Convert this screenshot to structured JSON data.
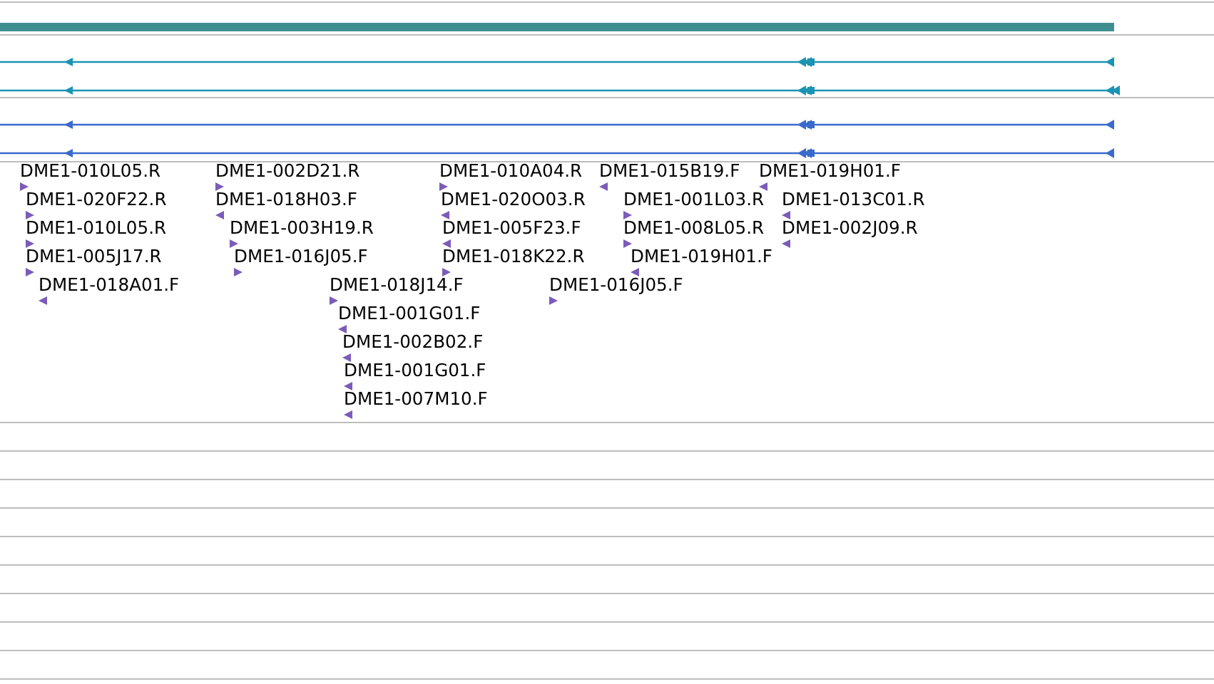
{
  "transcripts": [
    {
      "color": "#1b93b3"
    },
    {
      "color": "#1b93b3"
    },
    {
      "color": "#3a6acc"
    },
    {
      "color": "#3a6acc"
    }
  ],
  "reads": [
    {
      "label": "DME1-010L05.R",
      "kind": "forward"
    },
    {
      "label": "DME1-020F22.R",
      "kind": "forward"
    },
    {
      "label": "DME1-010L05.R",
      "kind": "forward"
    },
    {
      "label": "DME1-005J17.R",
      "kind": "forward"
    },
    {
      "label": "DME1-018A01.F",
      "kind": "reverse"
    },
    {
      "label": "DME1-002D21.R",
      "kind": "forward"
    },
    {
      "label": "DME1-018H03.F",
      "kind": "reverse"
    },
    {
      "label": "DME1-003H19.R",
      "kind": "forward"
    },
    {
      "label": "DME1-016J05.F",
      "kind": "forward"
    },
    {
      "label": "DME1-018J14.F",
      "kind": "forward"
    },
    {
      "label": "DME1-001G01.F",
      "kind": "reverse"
    },
    {
      "label": "DME1-002B02.F",
      "kind": "reverse"
    },
    {
      "label": "DME1-001G01.F",
      "kind": "reverse"
    },
    {
      "label": "DME1-007M10.F",
      "kind": "reverse"
    },
    {
      "label": "DME1-010A04.R",
      "kind": "forward"
    },
    {
      "label": "DME1-020O03.R",
      "kind": "reverse"
    },
    {
      "label": "DME1-005F23.F",
      "kind": "reverse"
    },
    {
      "label": "DME1-018K22.R",
      "kind": "forward"
    },
    {
      "label": "DME1-016J05.F",
      "kind": "forward"
    },
    {
      "label": "DME1-015B19.F",
      "kind": "reverse"
    },
    {
      "label": "DME1-001L03.R",
      "kind": "forward"
    },
    {
      "label": "DME1-008L05.R",
      "kind": "forward"
    },
    {
      "label": "DME1-019H01.F",
      "kind": "reverse"
    },
    {
      "label": "DME1-019H01.F",
      "kind": "reverse"
    },
    {
      "label": "DME1-013C01.R",
      "kind": "reverse"
    },
    {
      "label": "DME1-002J09.R",
      "kind": "reverse"
    }
  ]
}
